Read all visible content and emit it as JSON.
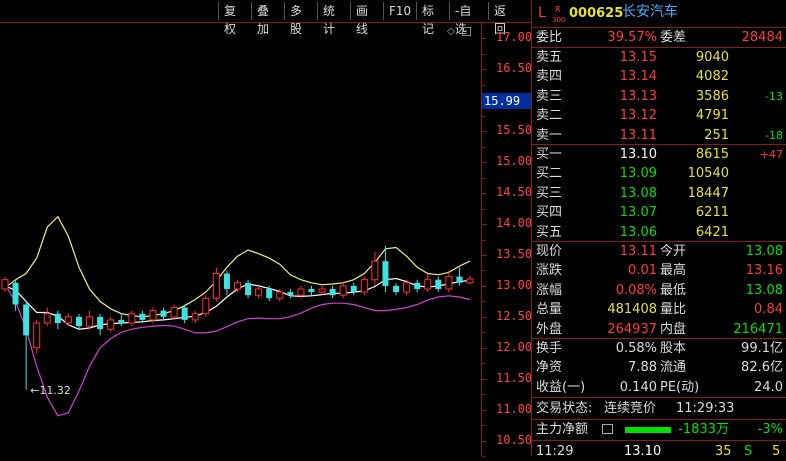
{
  "toolbar": {
    "items": [
      "复权",
      "叠加",
      "多股",
      "统计",
      "画线",
      "F10",
      "标记",
      "-自选",
      "返回"
    ]
  },
  "axis": {
    "ticks": [
      "17.00",
      "16.50",
      "16.00",
      "15.50",
      "15.00",
      "14.50",
      "14.00",
      "13.50",
      "13.00",
      "12.50",
      "12.00",
      "11.50",
      "11.00",
      "10.50"
    ],
    "current": "15.99"
  },
  "chart_data": {
    "type": "candlestick",
    "ylim": [
      10.25,
      17.25
    ],
    "annotation": "←11.32",
    "upper_band": [
      12.97,
      13.1,
      13.2,
      13.45,
      13.95,
      14.12,
      13.8,
      13.3,
      12.95,
      12.75,
      12.63,
      12.55,
      12.52,
      12.5,
      12.52,
      12.55,
      12.6,
      12.68,
      12.78,
      12.9,
      13.08,
      13.3,
      13.48,
      13.58,
      13.52,
      13.45,
      13.35,
      13.18,
      13.1,
      13.05,
      13.02,
      13.03,
      13.05,
      13.1,
      13.2,
      13.38,
      13.6,
      13.62,
      13.48,
      13.3,
      13.2,
      13.18,
      13.22,
      13.32,
      13.4
    ],
    "lower_band": [
      13.02,
      12.75,
      12.3,
      11.7,
      11.2,
      10.9,
      10.95,
      11.3,
      11.7,
      12.0,
      12.15,
      12.25,
      12.3,
      12.33,
      12.35,
      12.36,
      12.35,
      12.3,
      12.24,
      12.24,
      12.27,
      12.34,
      12.42,
      12.47,
      12.48,
      12.47,
      12.47,
      12.5,
      12.56,
      12.64,
      12.7,
      12.72,
      12.72,
      12.7,
      12.65,
      12.6,
      12.6,
      12.62,
      12.65,
      12.7,
      12.77,
      12.82,
      12.84,
      12.82,
      12.78
    ],
    "middle_band": [
      13.0,
      12.93,
      12.75,
      12.57,
      12.57,
      12.51,
      12.37,
      12.3,
      12.32,
      12.37,
      12.39,
      12.4,
      12.41,
      12.42,
      12.44,
      12.45,
      12.47,
      12.49,
      12.51,
      12.57,
      12.67,
      12.82,
      12.95,
      13.03,
      13.0,
      12.96,
      12.91,
      12.84,
      12.83,
      12.84,
      12.86,
      12.88,
      12.88,
      12.9,
      12.92,
      12.99,
      13.1,
      13.12,
      13.07,
      13.0,
      12.98,
      13.0,
      13.03,
      13.07,
      13.09
    ],
    "candles": [
      {
        "o": 12.95,
        "c": 13.1,
        "h": 13.15,
        "l": 12.9
      },
      {
        "o": 13.05,
        "c": 12.7,
        "h": 13.1,
        "l": 12.6
      },
      {
        "o": 12.7,
        "c": 12.2,
        "h": 12.75,
        "l": 11.32
      },
      {
        "o": 12.0,
        "c": 12.4,
        "h": 12.45,
        "l": 11.9
      },
      {
        "o": 12.4,
        "c": 12.55,
        "h": 12.65,
        "l": 12.35
      },
      {
        "o": 12.55,
        "c": 12.4,
        "h": 12.6,
        "l": 12.3
      },
      {
        "o": 12.4,
        "c": 12.5,
        "h": 12.55,
        "l": 12.35
      },
      {
        "o": 12.5,
        "c": 12.35,
        "h": 12.55,
        "l": 12.3
      },
      {
        "o": 12.35,
        "c": 12.5,
        "h": 12.6,
        "l": 12.3
      },
      {
        "o": 12.5,
        "c": 12.3,
        "h": 12.55,
        "l": 12.2
      },
      {
        "o": 12.3,
        "c": 12.45,
        "h": 12.5,
        "l": 12.25
      },
      {
        "o": 12.45,
        "c": 12.4,
        "h": 12.55,
        "l": 12.35
      },
      {
        "o": 12.4,
        "c": 12.55,
        "h": 12.6,
        "l": 12.35
      },
      {
        "o": 12.55,
        "c": 12.45,
        "h": 12.6,
        "l": 12.4
      },
      {
        "o": 12.45,
        "c": 12.6,
        "h": 12.65,
        "l": 12.4
      },
      {
        "o": 12.6,
        "c": 12.5,
        "h": 12.65,
        "l": 12.45
      },
      {
        "o": 12.5,
        "c": 12.65,
        "h": 12.7,
        "l": 12.45
      },
      {
        "o": 12.65,
        "c": 12.45,
        "h": 12.7,
        "l": 12.4
      },
      {
        "o": 12.45,
        "c": 12.55,
        "h": 12.6,
        "l": 12.4
      },
      {
        "o": 12.55,
        "c": 12.8,
        "h": 12.85,
        "l": 12.5
      },
      {
        "o": 12.8,
        "c": 13.2,
        "h": 13.3,
        "l": 12.75
      },
      {
        "o": 13.2,
        "c": 12.95,
        "h": 13.25,
        "l": 12.85
      },
      {
        "o": 12.95,
        "c": 13.05,
        "h": 13.1,
        "l": 12.9
      },
      {
        "o": 13.05,
        "c": 12.85,
        "h": 13.1,
        "l": 12.8
      },
      {
        "o": 12.85,
        "c": 12.95,
        "h": 13.0,
        "l": 12.8
      },
      {
        "o": 12.95,
        "c": 12.8,
        "h": 13.0,
        "l": 12.75
      },
      {
        "o": 12.8,
        "c": 12.9,
        "h": 12.95,
        "l": 12.75
      },
      {
        "o": 12.9,
        "c": 12.85,
        "h": 12.95,
        "l": 12.8
      },
      {
        "o": 12.85,
        "c": 12.95,
        "h": 13.0,
        "l": 12.8
      },
      {
        "o": 12.95,
        "c": 12.9,
        "h": 13.0,
        "l": 12.85
      },
      {
        "o": 12.9,
        "c": 12.95,
        "h": 13.0,
        "l": 12.85
      },
      {
        "o": 12.95,
        "c": 12.85,
        "h": 13.0,
        "l": 12.8
      },
      {
        "o": 12.85,
        "c": 13.0,
        "h": 13.05,
        "l": 12.8
      },
      {
        "o": 13.0,
        "c": 12.9,
        "h": 13.05,
        "l": 12.85
      },
      {
        "o": 12.9,
        "c": 13.1,
        "h": 13.15,
        "l": 12.85
      },
      {
        "o": 13.1,
        "c": 13.4,
        "h": 13.55,
        "l": 13.0
      },
      {
        "o": 13.4,
        "c": 13.0,
        "h": 13.65,
        "l": 12.9
      },
      {
        "o": 13.0,
        "c": 12.9,
        "h": 13.05,
        "l": 12.85
      },
      {
        "o": 12.9,
        "c": 13.05,
        "h": 13.1,
        "l": 12.85
      },
      {
        "o": 13.05,
        "c": 12.95,
        "h": 13.1,
        "l": 12.9
      },
      {
        "o": 12.95,
        "c": 13.1,
        "h": 13.2,
        "l": 12.9
      },
      {
        "o": 13.1,
        "c": 12.95,
        "h": 13.15,
        "l": 12.9
      },
      {
        "o": 12.95,
        "c": 13.15,
        "h": 13.25,
        "l": 12.9
      },
      {
        "o": 13.15,
        "c": 13.05,
        "h": 13.3,
        "l": 13.0
      },
      {
        "o": 13.05,
        "c": 13.11,
        "h": 13.16,
        "l": 13.02
      }
    ]
  },
  "header": {
    "prefix": "L",
    "r": "R",
    "num": "300",
    "code": "000625",
    "name": "长安汽车"
  },
  "weibi": {
    "label": "委比",
    "value": "39.57%",
    "label2": "委差",
    "value2": "28484"
  },
  "asks": [
    {
      "label": "卖五",
      "price": "13.15",
      "vol": "9040",
      "chg": ""
    },
    {
      "label": "卖四",
      "price": "13.14",
      "vol": "4082",
      "chg": ""
    },
    {
      "label": "卖三",
      "price": "13.13",
      "vol": "3586",
      "chg": "-13"
    },
    {
      "label": "卖二",
      "price": "13.12",
      "vol": "4791",
      "chg": ""
    },
    {
      "label": "卖一",
      "price": "13.11",
      "vol": "251",
      "chg": "-18"
    }
  ],
  "bids": [
    {
      "label": "买一",
      "price": "13.10",
      "vol": "8615",
      "chg": "+47"
    },
    {
      "label": "买二",
      "price": "13.09",
      "vol": "10540",
      "chg": ""
    },
    {
      "label": "买三",
      "price": "13.08",
      "vol": "18447",
      "chg": ""
    },
    {
      "label": "买四",
      "price": "13.07",
      "vol": "6211",
      "chg": ""
    },
    {
      "label": "买五",
      "price": "13.06",
      "vol": "6421",
      "chg": ""
    }
  ],
  "quote": [
    {
      "l1": "现价",
      "v1": "13.11",
      "l2": "今开",
      "v2": "13.08"
    },
    {
      "l1": "涨跌",
      "v1": "0.01",
      "l2": "最高",
      "v2": "13.16"
    },
    {
      "l1": "涨幅",
      "v1": "0.08%",
      "l2": "最低",
      "v2": "13.08"
    },
    {
      "l1": "总量",
      "v1": "481408",
      "l2": "量比",
      "v2": "0.84"
    },
    {
      "l1": "外盘",
      "v1": "264937",
      "l2": "内盘",
      "v2": "216471"
    }
  ],
  "fund": [
    {
      "l1": "换手",
      "v1": "0.58%",
      "l2": "股本",
      "v2": "99.1亿"
    },
    {
      "l1": "净资",
      "v1": "7.88",
      "l2": "流通",
      "v2": "82.6亿"
    },
    {
      "l1": "收益(一)",
      "v1": "0.140",
      "l2": "PE(动)",
      "v2": "24.0"
    }
  ],
  "status": {
    "label": "交易状态:",
    "value": "连续竞价",
    "time": "11:29:33"
  },
  "netflow": {
    "label": "主力净额",
    "value": "-1833万",
    "pct": "-3%"
  },
  "tick": {
    "time": "11:29",
    "price": "13.10",
    "vol": "35",
    "side": "S",
    "count": "5"
  }
}
